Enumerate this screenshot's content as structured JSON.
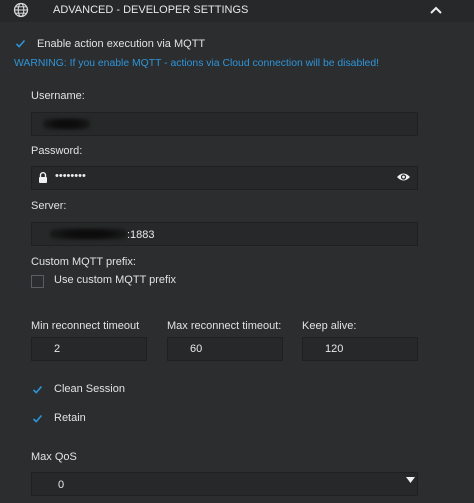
{
  "header": {
    "title": "ADVANCED - DEVELOPER SETTINGS",
    "icon": "globe-icon",
    "toggle_icon": "chevron-up-icon"
  },
  "mqtt_enable": {
    "label": "Enable action execution via MQTT",
    "checked": true
  },
  "warning": "WARNING: If you enable MQTT - actions via Cloud connection will be disabled!",
  "username": {
    "label": "Username:",
    "value": ""
  },
  "password": {
    "label": "Password:",
    "value": "••••••••",
    "lock_icon": "lock-icon",
    "reveal_icon": "eye-icon"
  },
  "server": {
    "label": "Server:",
    "value_suffix": ":1883"
  },
  "custom_prefix": {
    "label": "Custom MQTT prefix:",
    "checkbox_label": "Use custom MQTT prefix",
    "checked": false
  },
  "min_reconnect": {
    "label": "Min reconnect timeout",
    "value": "2"
  },
  "max_reconnect": {
    "label": "Max reconnect timeout:",
    "value": "60"
  },
  "keep_alive": {
    "label": "Keep alive:",
    "value": "120"
  },
  "clean_session": {
    "label": "Clean Session",
    "checked": true
  },
  "retain": {
    "label": "Retain",
    "checked": true
  },
  "max_qos": {
    "label": "Max QoS",
    "value": "0",
    "dropdown_icon": "caret-down-icon"
  },
  "colors": {
    "accent": "#2f95d8",
    "background": "#2b2d2f",
    "field": "#262829"
  }
}
